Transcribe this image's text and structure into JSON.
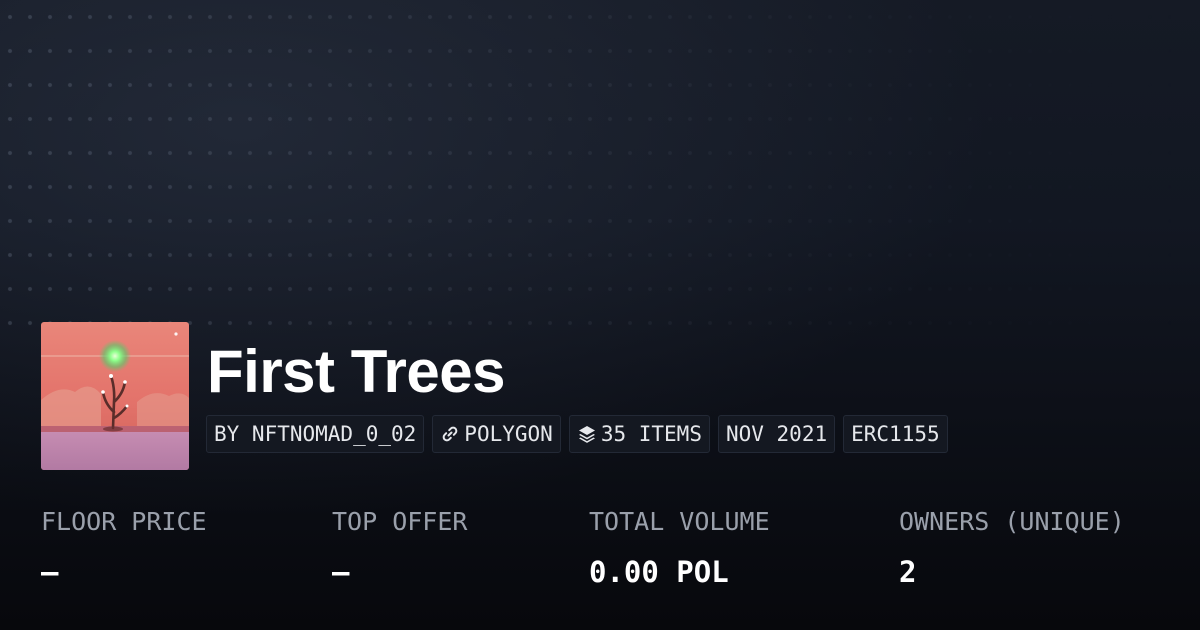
{
  "collection": {
    "title": "First Trees",
    "thumbnail_icon": "collection-artwork"
  },
  "tags": {
    "creator": "BY NFTNOMAD_0_02",
    "chain": "POLYGON",
    "chain_icon": "link-icon",
    "items": "35 ITEMS",
    "items_icon": "layers-icon",
    "date": "NOV 2021",
    "standard": "ERC1155"
  },
  "stats": {
    "floor_price": {
      "label": "FLOOR PRICE",
      "value": "–"
    },
    "top_offer": {
      "label": "TOP OFFER",
      "value": "–"
    },
    "total_volume": {
      "label": "TOTAL VOLUME",
      "value": "0.00 POL"
    },
    "owners": {
      "label": "OWNERS (UNIQUE)",
      "value": "2"
    }
  },
  "colors": {
    "background": "#0b0e14",
    "text": "#ffffff",
    "muted_label": "#9aa0ab",
    "tag_background": "#141821",
    "tag_border": "#232936"
  }
}
